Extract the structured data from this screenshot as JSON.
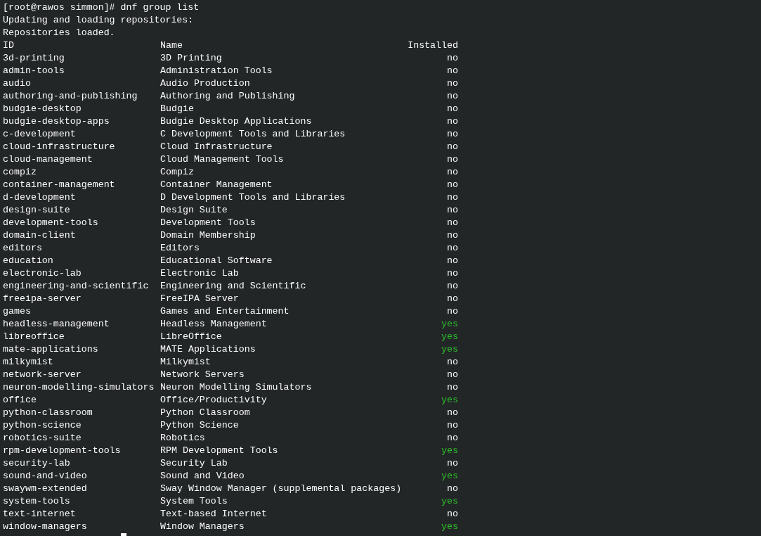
{
  "terminal": {
    "lines": [
      "[root@rawos simmon]# dnf group list",
      "Updating and loading repositories:",
      "Repositories loaded."
    ],
    "table": {
      "columns": [
        "ID",
        "Name",
        "Installed"
      ],
      "rows": [
        {
          "id": "3d-printing",
          "name": "3D Printing",
          "installed": "no",
          "color": "#fcfcfc"
        },
        {
          "id": "admin-tools",
          "name": "Administration Tools",
          "installed": "no",
          "color": "#fcfcfc"
        },
        {
          "id": "audio",
          "name": "Audio Production",
          "installed": "no",
          "color": "#fcfcfc"
        },
        {
          "id": "authoring-and-publishing",
          "name": "Authoring and Publishing",
          "installed": "no",
          "color": "#fcfcfc"
        },
        {
          "id": "budgie-desktop",
          "name": "Budgie",
          "installed": "no",
          "color": "#fcfcfc"
        },
        {
          "id": "budgie-desktop-apps",
          "name": "Budgie Desktop Applications",
          "installed": "no",
          "color": "#fcfcfc"
        },
        {
          "id": "c-development",
          "name": "C Development Tools and Libraries",
          "installed": "no",
          "color": "#fcfcfc"
        },
        {
          "id": "cloud-infrastructure",
          "name": "Cloud Infrastructure",
          "installed": "no",
          "color": "#fcfcfc"
        },
        {
          "id": "cloud-management",
          "name": "Cloud Management Tools",
          "installed": "no",
          "color": "#fcfcfc"
        },
        {
          "id": "compiz",
          "name": "Compiz",
          "installed": "no",
          "color": "#fcfcfc"
        },
        {
          "id": "container-management",
          "name": "Container Management",
          "installed": "no",
          "color": "#fcfcfc"
        },
        {
          "id": "d-development",
          "name": "D Development Tools and Libraries",
          "installed": "no",
          "color": "#fcfcfc"
        },
        {
          "id": "design-suite",
          "name": "Design Suite",
          "installed": "no",
          "color": "#fcfcfc"
        },
        {
          "id": "development-tools",
          "name": "Development Tools",
          "installed": "no",
          "color": "#fcfcfc"
        },
        {
          "id": "domain-client",
          "name": "Domain Membership",
          "installed": "no",
          "color": "#fcfcfc"
        },
        {
          "id": "editors",
          "name": "Editors",
          "installed": "no",
          "color": "#fcfcfc"
        },
        {
          "id": "education",
          "name": "Educational Software",
          "installed": "no",
          "color": "#fcfcfc"
        },
        {
          "id": "electronic-lab",
          "name": "Electronic Lab",
          "installed": "no",
          "color": "#fcfcfc"
        },
        {
          "id": "engineering-and-scientific",
          "name": "Engineering and Scientific",
          "installed": "no",
          "color": "#fcfcfc"
        },
        {
          "id": "freeipa-server",
          "name": "FreeIPA Server",
          "installed": "no",
          "color": "#fcfcfc"
        },
        {
          "id": "games",
          "name": "Games and Entertainment",
          "installed": "no",
          "color": "#fcfcfc"
        },
        {
          "id": "headless-management",
          "name": "Headless Management",
          "installed": "yes",
          "color": "#2bbd2b"
        },
        {
          "id": "libreoffice",
          "name": "LibreOffice",
          "installed": "yes",
          "color": "#2bbd2b"
        },
        {
          "id": "mate-applications",
          "name": "MATE Applications",
          "installed": "yes",
          "color": "#2bbd2b"
        },
        {
          "id": "milkymist",
          "name": "Milkymist",
          "installed": "no",
          "color": "#fcfcfc"
        },
        {
          "id": "network-server",
          "name": "Network Servers",
          "installed": "no",
          "color": "#fcfcfc"
        },
        {
          "id": "neuron-modelling-simulators",
          "name": "Neuron Modelling Simulators",
          "installed": "no",
          "color": "#fcfcfc"
        },
        {
          "id": "office",
          "name": "Office/Productivity",
          "installed": "yes",
          "color": "#2bbd2b"
        },
        {
          "id": "python-classroom",
          "name": "Python Classroom",
          "installed": "no",
          "color": "#fcfcfc"
        },
        {
          "id": "python-science",
          "name": "Python Science",
          "installed": "no",
          "color": "#fcfcfc"
        },
        {
          "id": "robotics-suite",
          "name": "Robotics",
          "installed": "no",
          "color": "#fcfcfc"
        },
        {
          "id": "rpm-development-tools",
          "name": "RPM Development Tools",
          "installed": "yes",
          "color": "#2bbd2b"
        },
        {
          "id": "security-lab",
          "name": "Security Lab",
          "installed": "no",
          "color": "#fcfcfc"
        },
        {
          "id": "sound-and-video",
          "name": "Sound and Video",
          "installed": "yes",
          "color": "#2bbd2b"
        },
        {
          "id": "swaywm-extended",
          "name": "Sway Window Manager (supplemental packages)",
          "installed": "no",
          "color": "#fcfcfc"
        },
        {
          "id": "system-tools",
          "name": "System Tools",
          "installed": "yes",
          "color": "#2bbd2b"
        },
        {
          "id": "text-internet",
          "name": "Text-based Internet",
          "installed": "no",
          "color": "#fcfcfc"
        },
        {
          "id": "window-managers",
          "name": "Window Managers",
          "installed": "yes",
          "color": "#2bbd2b"
        }
      ]
    }
  }
}
